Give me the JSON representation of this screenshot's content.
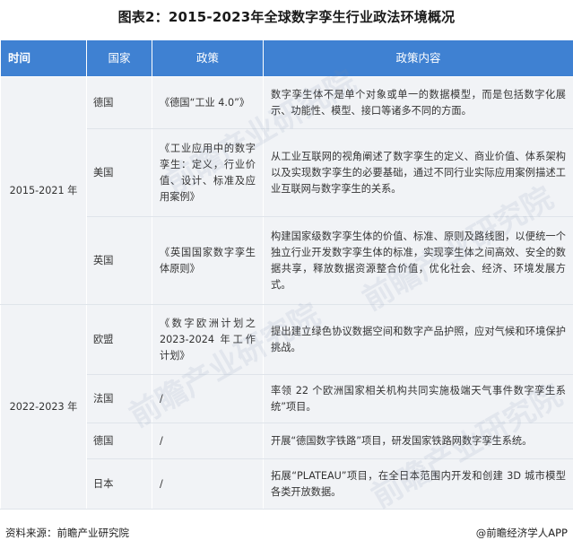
{
  "title": "图表2：2015-2023年全球数字孪生行业政法环境概况",
  "headers": {
    "time": "时间",
    "country": "国家",
    "policy": "政策",
    "content": "政策内容"
  },
  "periods": {
    "p1": "2015-2021 年",
    "p2": "2022-2023 年"
  },
  "rows": [
    {
      "country": "德国",
      "policy": "《德国“工业 4.0”》",
      "content": "数字孪生体不是单个对象或单一的数据模型，而是包括数字化展示、功能性、模型、接口等诸多不同的方面。"
    },
    {
      "country": "美国",
      "policy": "《工业应用中的数字孪生：定义，行业价值、设计、标准及应用案例》",
      "content": "从工业互联网的视角阐述了数字孪生的定义、商业价值、体系架构以及实现数字孪生的必要基础，通过不同行业实际应用案例描述工业互联网与数字孪生的关系。"
    },
    {
      "country": "英国",
      "policy": "《英国国家数字孪生体原则》",
      "content": "构建国家级数字孪生体的价值、标准、原则及路线图，以便统一个独立行业开发数字孪生体的标准，实现孪生体之间高效、安全的数据共享，释放数据资源整合价值，优化社会、经济、环境发展方式。"
    },
    {
      "country": "欧盟",
      "policy": "《数字欧洲计划之2023-2024 年工作计划》",
      "content": "提出建立绿色协议数据空间和数字产品护照，应对气候和环境保护挑战。"
    },
    {
      "country": "法国",
      "policy": "/",
      "content": "率领 22 个欧洲国家相关机构共同实施极端天气事件数字孪生系统”项目。"
    },
    {
      "country": "德国",
      "policy": "/",
      "content": "开展“德国数字铁路”项目，研发国家铁路网数字孪生系统。"
    },
    {
      "country": "日本",
      "policy": "/",
      "content": "拓展“PLATEAU”项目，在全日本范围内开发和创建 3D 城市模型各类开放数据。"
    }
  ],
  "footer": {
    "source": "资料来源：前瞻产业研究院",
    "brand": "@前瞻经济学人APP"
  },
  "watermark": "前瞻产业研究院",
  "colors": {
    "header_bg": "#3f81d2",
    "row_bg": "#f1f3f6"
  }
}
